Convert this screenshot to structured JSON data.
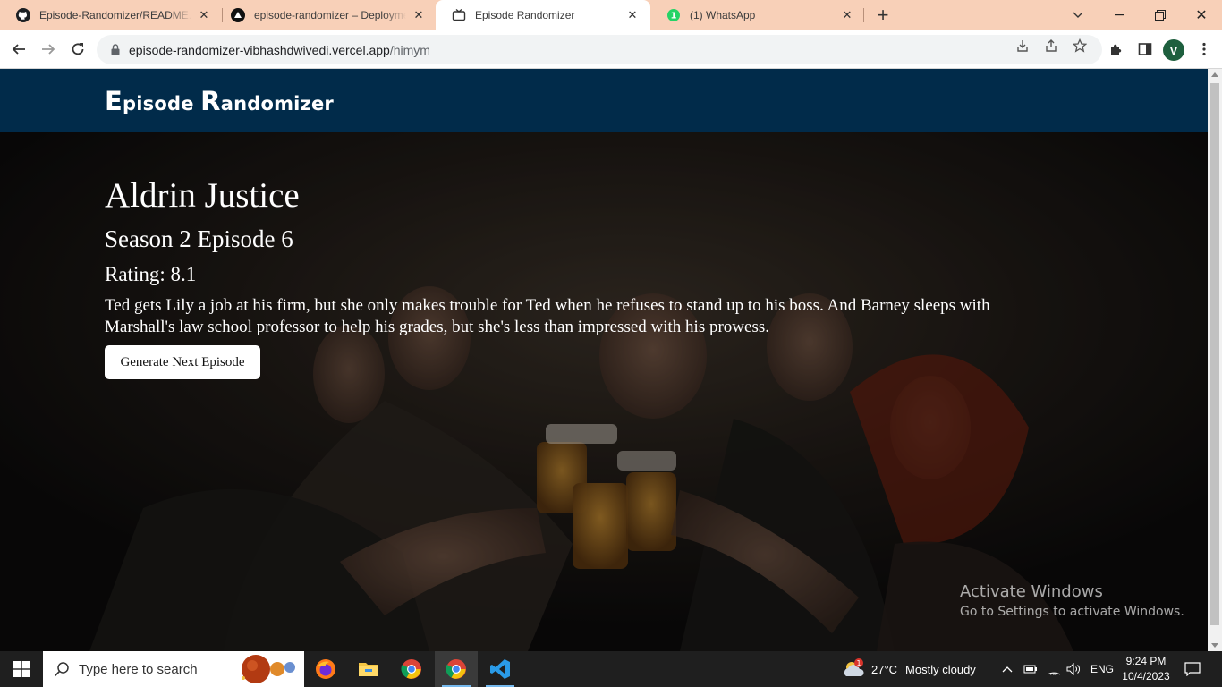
{
  "browser": {
    "tabs": [
      {
        "title": "Episode-Randomizer/README.md",
        "favicon": "github-icon"
      },
      {
        "title": "episode-randomizer – Deployments",
        "favicon": "vercel-icon"
      },
      {
        "title": "Episode Randomizer",
        "favicon": "tv-icon",
        "active": true
      },
      {
        "title": "(1) WhatsApp",
        "favicon": "whatsapp-icon",
        "badge": "1"
      }
    ],
    "address": {
      "host": "episode-randomizer-vibhashdwivedi.vercel.app",
      "path": "/himym"
    },
    "profile_initial": "V"
  },
  "site": {
    "brand_first_cap": "E",
    "brand_first_rest": "pisode ",
    "brand_second_cap": "R",
    "brand_second_rest": "andomizer",
    "header_color": "#012b4a"
  },
  "episode": {
    "title": "Aldrin Justice",
    "season_episode": "Season 2 Episode 6",
    "rating": "Rating: 8.1",
    "description": "Ted gets Lily a job at his firm, but she only makes trouble for Ted when he refuses to stand up to his boss. And Barney sleeps with Marshall's law school professor to help his grades, but she's less than impressed with his prowess.",
    "button_label": "Generate Next Episode"
  },
  "watermark": {
    "line1": "Activate Windows",
    "line2": "Go to Settings to activate Windows."
  },
  "taskbar": {
    "search_placeholder": "Type here to search",
    "apps": [
      "firefox-icon",
      "file-explorer-icon",
      "chrome-icon",
      "chrome-icon",
      "vscode-icon"
    ],
    "weather_temp": "27°C",
    "weather_text": "Mostly cloudy",
    "weather_badge": "1",
    "language": "ENG",
    "time": "9:24 PM",
    "date": "10/4/2023"
  }
}
